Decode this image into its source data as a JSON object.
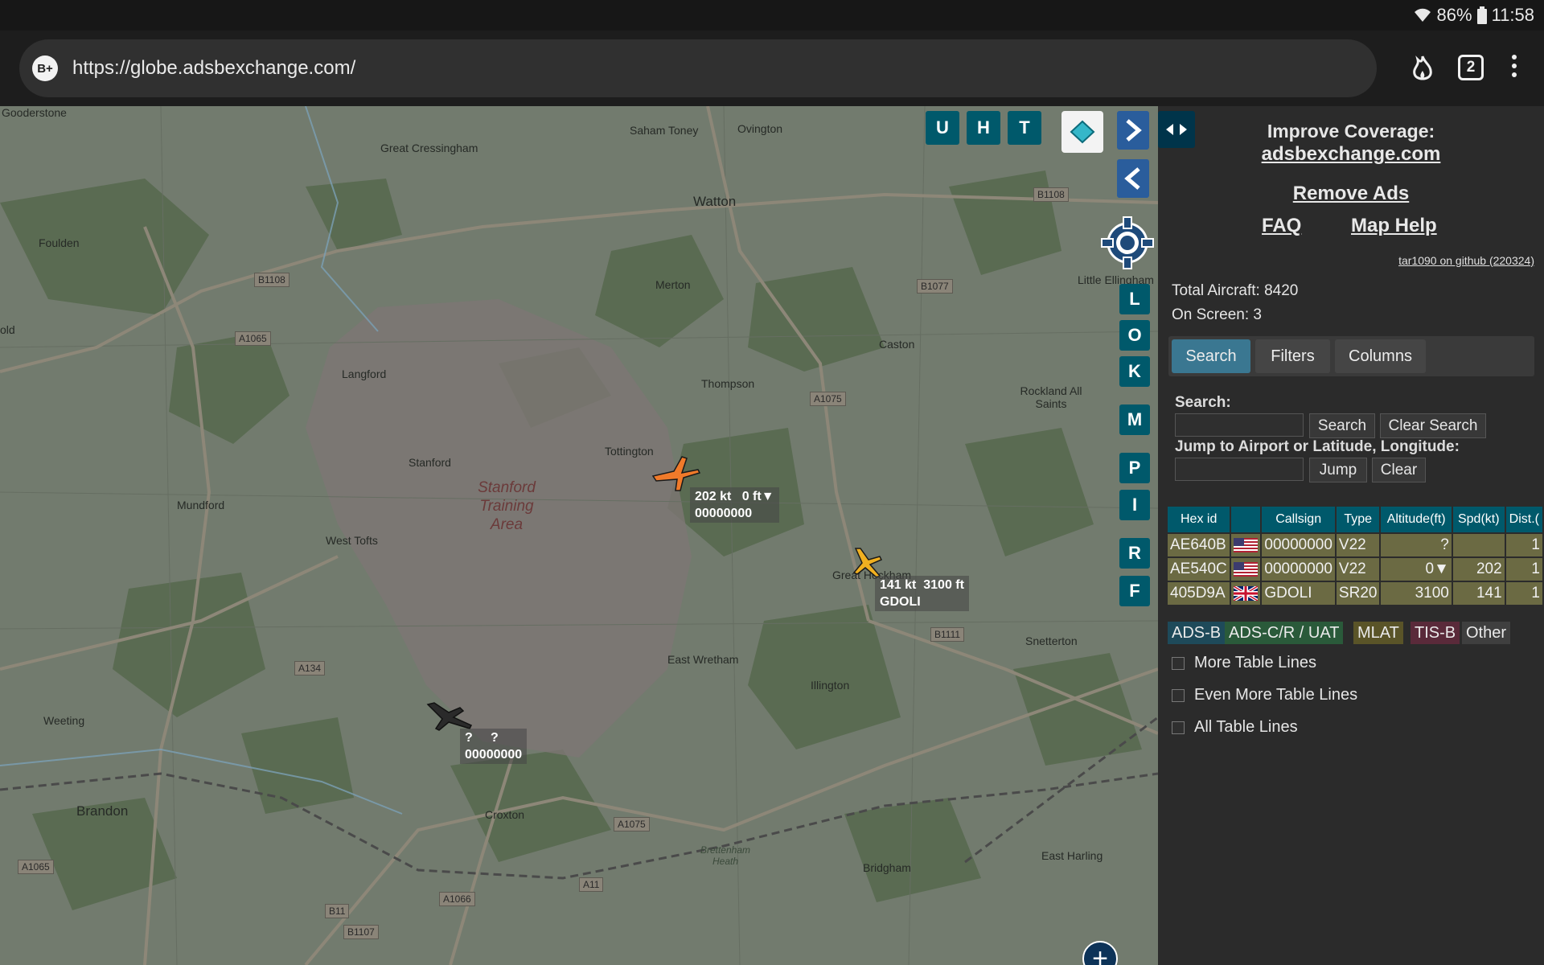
{
  "status_bar": {
    "battery": "86%",
    "time": "11:58"
  },
  "browser": {
    "site_badge": "B+",
    "url": "https://globe.adsbexchange.com/",
    "tab_count": "2"
  },
  "map": {
    "places": [
      {
        "name": "Gooderstone"
      },
      {
        "name": "Great Cressingham"
      },
      {
        "name": "Saham Toney"
      },
      {
        "name": "Ovington"
      },
      {
        "name": "Watton"
      },
      {
        "name": "Foulden"
      },
      {
        "name": "Merton"
      },
      {
        "name": "Caston"
      },
      {
        "name": "Little Ellingham"
      },
      {
        "name": "Langford"
      },
      {
        "name": "Thompson"
      },
      {
        "name": "Rockland All Saints"
      },
      {
        "name": "Tottington"
      },
      {
        "name": "Stanford"
      },
      {
        "name": "Mundford"
      },
      {
        "name": "West Tofts"
      },
      {
        "name": "Great Hockham"
      },
      {
        "name": "East Wretham"
      },
      {
        "name": "Illington"
      },
      {
        "name": "Snetterton"
      },
      {
        "name": "Weeting"
      },
      {
        "name": "Brandon"
      },
      {
        "name": "Croxton"
      },
      {
        "name": "Bridgham"
      },
      {
        "name": "East Harling"
      },
      {
        "name": "Brettenham Heath"
      },
      {
        "name": "old"
      }
    ],
    "roads": [
      "B1108",
      "B1108",
      "A1065",
      "B1077",
      "A1075",
      "B1111",
      "A134",
      "A1075",
      "A1065",
      "A1066",
      "A11",
      "B11",
      "B1107"
    ],
    "training_area": "Stanford Training Area",
    "aircraft_labels": [
      {
        "line1": "202 kt   0 ft▼",
        "line2": "00000000"
      },
      {
        "line1": "141 kt  3100 ft",
        "line2": "GDOLI"
      },
      {
        "line1": "?     ?",
        "line2": "00000000"
      }
    ],
    "buttons": {
      "u": "U",
      "h": "H",
      "t": "T",
      "l": "L",
      "o": "O",
      "k": "K",
      "m": "M",
      "p": "P",
      "i": "I",
      "r": "R",
      "f": "F"
    }
  },
  "sidebar": {
    "improve_coverage": "Improve Coverage:",
    "site_link": "adsbexchange.com",
    "remove_ads": "Remove Ads",
    "faq": "FAQ",
    "map_help": "Map Help",
    "github": "tar1090 on github (220324)",
    "total_aircraft": "Total Aircraft: 8420",
    "on_screen": "On Screen: 3",
    "tabs": [
      "Search",
      "Filters",
      "Columns"
    ],
    "search_label": "Search:",
    "search_button": "Search",
    "clear_search_button": "Clear Search",
    "jump_label": "Jump to Airport or Latitude, Longitude:",
    "jump_button": "Jump",
    "clear_button": "Clear",
    "table": {
      "headers": [
        "Hex id",
        "",
        "Callsign",
        "Type",
        "Altitude(ft)",
        "Spd(kt)",
        "Dist.("
      ],
      "rows": [
        {
          "hex": "AE640B",
          "flag": "us",
          "callsign": "00000000",
          "type": "V22",
          "alt": "?",
          "spd": "",
          "dist": "1"
        },
        {
          "hex": "AE540C",
          "flag": "us",
          "callsign": "00000000",
          "type": "V22",
          "alt": "0▼",
          "spd": "202",
          "dist": "1"
        },
        {
          "hex": "405D9A",
          "flag": "gb",
          "callsign": "GDOLI",
          "type": "SR20",
          "alt": "3100",
          "spd": "141",
          "dist": "1"
        }
      ]
    },
    "legend": [
      {
        "label": "ADS-B",
        "color": "#1e4a5a"
      },
      {
        "label": "ADS-C/R / UAT",
        "color": "#2a5a3a"
      },
      {
        "label": "MLAT",
        "color": "#5a5428"
      },
      {
        "label": "TIS-B",
        "color": "#5a2a3a"
      },
      {
        "label": "Other",
        "color": "#3f3f3f"
      }
    ],
    "checkboxes": [
      "More Table Lines",
      "Even More Table Lines",
      "All Table Lines"
    ]
  }
}
